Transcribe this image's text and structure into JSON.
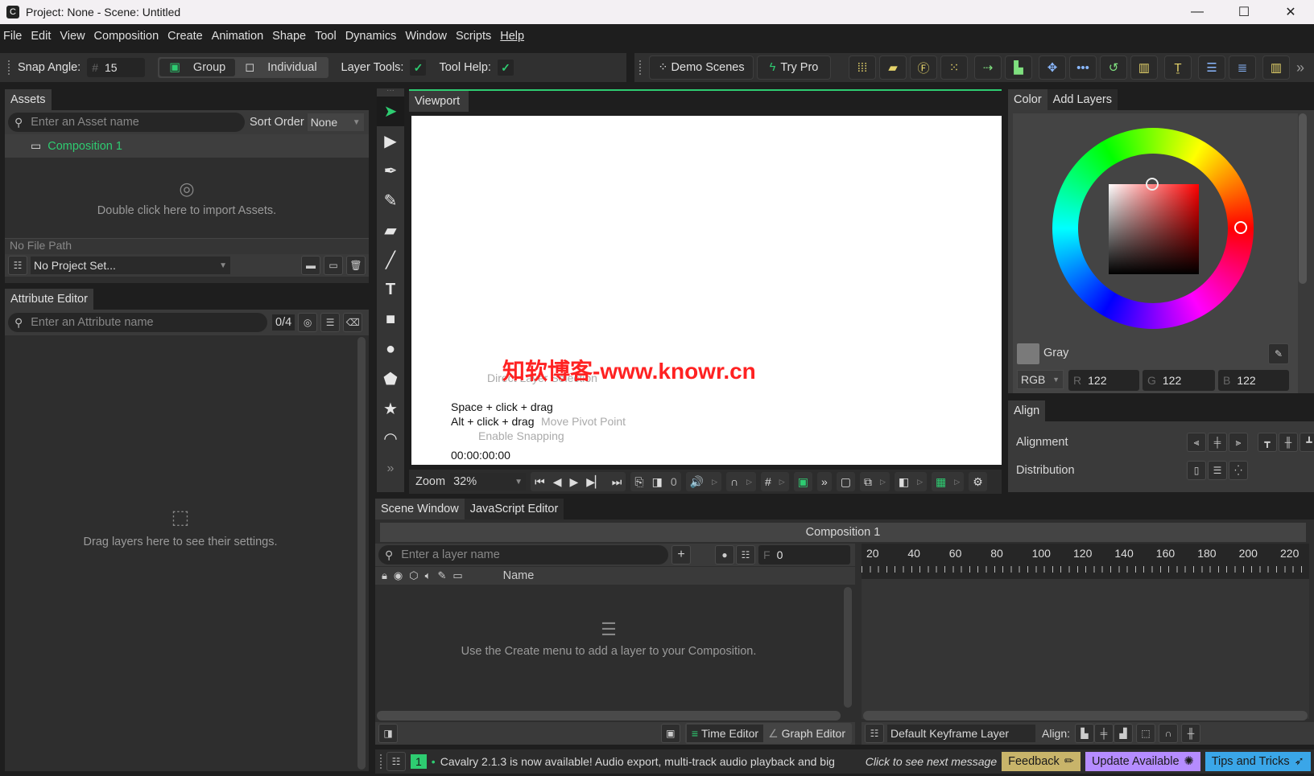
{
  "window": {
    "title": "Project: None - Scene: Untitled",
    "app_icon": "cavalry-app-icon",
    "controls": {
      "minimize": "—",
      "maximize": "☐",
      "close": "✕"
    }
  },
  "menubar": [
    "File",
    "Edit",
    "View",
    "Composition",
    "Create",
    "Animation",
    "Shape",
    "Tool",
    "Dynamics",
    "Window",
    "Scripts",
    "Help"
  ],
  "toolbar": {
    "snap_angle_label": "Snap Angle:",
    "snap_angle_prefix": "#",
    "snap_angle_value": "15",
    "group_label": "Group",
    "individual_label": "Individual",
    "layer_tools_label": "Layer Tools:",
    "layer_tools_checked": "✓",
    "tool_help_label": "Tool Help:",
    "tool_help_checked": "✓",
    "demo_scenes_label": "Demo Scenes",
    "try_pro_label": "Try Pro",
    "more_label": "»"
  },
  "assets": {
    "tab": "Assets",
    "search_placeholder": "Enter an Asset name",
    "sort_label": "Sort Order",
    "sort_value": "None",
    "items": [
      {
        "label": "Composition 1"
      }
    ],
    "import_hint": "Double click here to import Assets.",
    "file_path": "No File Path",
    "project_select": "No Project Set..."
  },
  "attribute_editor": {
    "tab": "Attribute Editor",
    "search_placeholder": "Enter an Attribute name",
    "count": "0/4",
    "hint": "Drag layers here to see their settings."
  },
  "viewport": {
    "tab": "Viewport",
    "hint_title": "Direct Layer Selection",
    "hint_line1": "Space + click + drag",
    "hint_line2_key": "Alt + click + drag",
    "hint_line2_desc": "Move Pivot Point",
    "hint_line3": "Enable Snapping",
    "timecode": "00:00:00:00",
    "watermark": "知软博客-www.knowr.cn",
    "zoom_label": "Zoom",
    "zoom_value": "32%",
    "frame_value": "0"
  },
  "color_panel": {
    "tabs": [
      "Color",
      "Add Layers"
    ],
    "color_name": "Gray",
    "mode": "RGB",
    "r_label": "R",
    "r": "122",
    "g_label": "G",
    "g": "122",
    "b_label": "B",
    "b": "122",
    "swatch": "#7a7a7a",
    "hue_marker": "red"
  },
  "align_panel": {
    "tab": "Align",
    "alignment_label": "Alignment",
    "distribution_label": "Distribution"
  },
  "scene_window": {
    "tabs": [
      "Scene Window",
      "JavaScript Editor"
    ],
    "composition_title": "Composition 1",
    "layer_search_placeholder": "Enter a layer name",
    "frame_prefix": "F",
    "frame_value": "0",
    "name_column": "Name",
    "empty_hint": "Use the Create menu to add a layer to your Composition.",
    "ruler_ticks": [
      "20",
      "40",
      "60",
      "80",
      "100",
      "120",
      "140",
      "160",
      "180",
      "200",
      "220"
    ],
    "time_editor_label": "Time Editor",
    "graph_editor_label": "Graph Editor",
    "keyframe_layer": "Default Keyframe Layer",
    "align_label": "Align:"
  },
  "status_bar": {
    "count": "1",
    "message": "Cavalry 2.1.3 is now available! Audio export, multi-track audio playback and big",
    "next_message": "Click to see next message",
    "feedback": "Feedback",
    "update": "Update Available",
    "tips": "Tips and Tricks",
    "colors": {
      "feedback": "#c8b46a",
      "update": "#b58cff",
      "tips": "#3aa6e8"
    }
  },
  "accent_color": "#2ecc71"
}
